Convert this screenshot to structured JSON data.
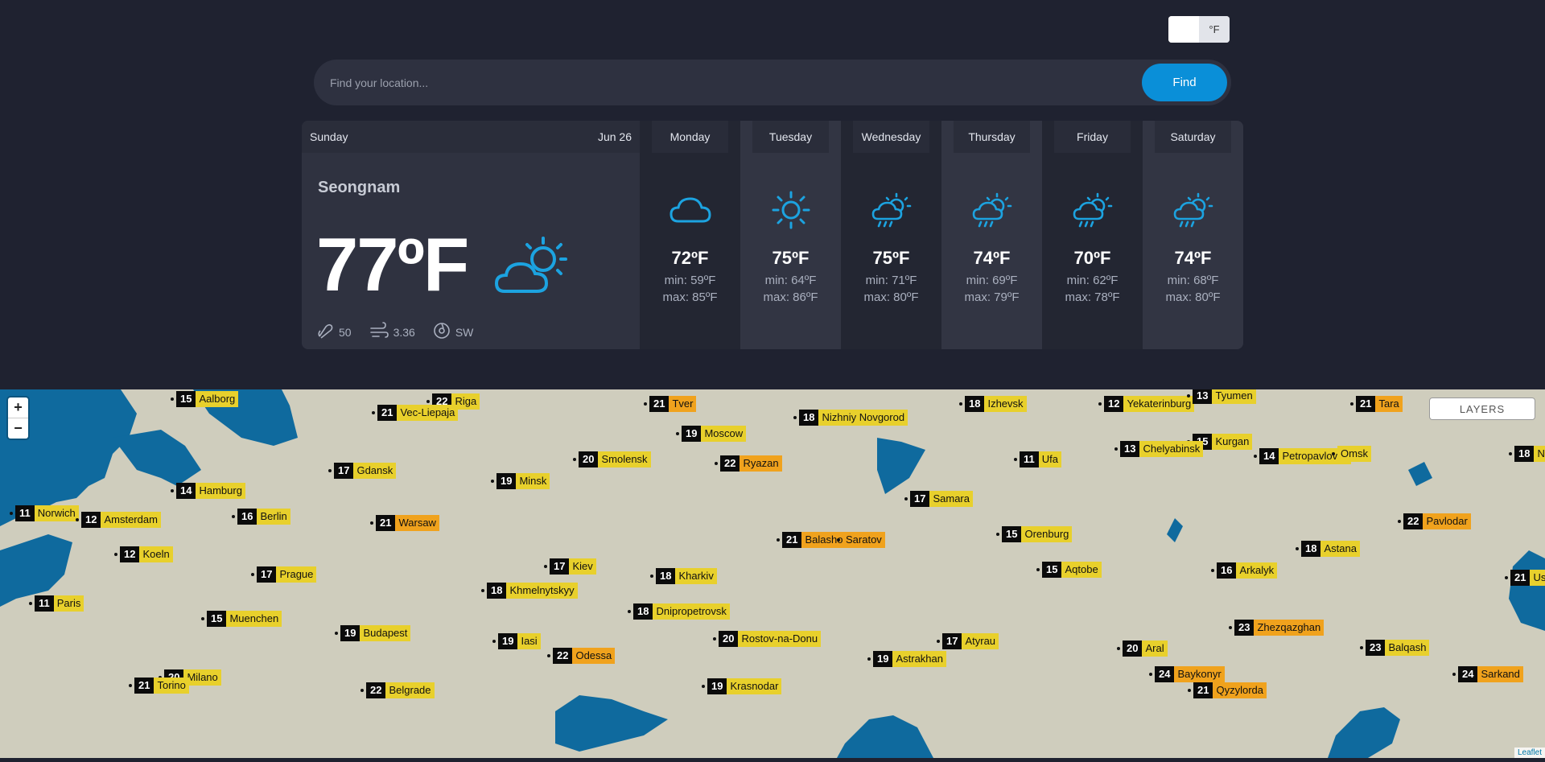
{
  "unit_toggle": {
    "celsius": "",
    "fahrenheit": "°F"
  },
  "search": {
    "placeholder": "Find your location...",
    "button": "Find"
  },
  "today": {
    "day": "Sunday",
    "date": "Jun 26",
    "city": "Seongnam",
    "temp": "77ºF",
    "icon": "partly-cloudy-sun-icon",
    "humidity": "50",
    "wind_speed": "3.36",
    "wind_dir": "SW"
  },
  "days": [
    {
      "name": "Monday",
      "icon": "cloud-icon",
      "hi": "72ºF",
      "min": "min: 59ºF",
      "max": "max: 85ºF"
    },
    {
      "name": "Tuesday",
      "icon": "sun-icon",
      "hi": "75ºF",
      "min": "min: 64ºF",
      "max": "max: 86ºF"
    },
    {
      "name": "Wednesday",
      "icon": "sun-cloud-rain-icon",
      "hi": "75ºF",
      "min": "min: 71ºF",
      "max": "max: 80ºF"
    },
    {
      "name": "Thursday",
      "icon": "sun-cloud-rain-icon",
      "hi": "74ºF",
      "min": "min: 69ºF",
      "max": "max: 79ºF"
    },
    {
      "name": "Friday",
      "icon": "sun-cloud-rain-icon",
      "hi": "70ºF",
      "min": "min: 62ºF",
      "max": "max: 78ºF"
    },
    {
      "name": "Saturday",
      "icon": "sun-cloud-rain-icon",
      "hi": "74ºF",
      "min": "min: 68ºF",
      "max": "max: 80ºF"
    }
  ],
  "map": {
    "zoom_in": "+",
    "zoom_out": "−",
    "layers": "LAYERS",
    "attribution": "Leaflet",
    "cities": [
      {
        "t": "15",
        "n": "Aalborg",
        "c": "y"
      },
      {
        "t": "22",
        "n": "Riga",
        "c": "y"
      },
      {
        "t": "21",
        "n": "Vec-Liepaja",
        "c": "y"
      },
      {
        "t": "21",
        "n": "Tver",
        "c": "o"
      },
      {
        "t": "18",
        "n": "Izhevsk",
        "c": "y"
      },
      {
        "t": "12",
        "n": "Yekaterinburg",
        "c": "y"
      },
      {
        "t": "13",
        "n": "Tyumen",
        "c": "y"
      },
      {
        "t": "21",
        "n": "Tara",
        "c": "o"
      },
      {
        "t": "19",
        "n": "Moscow",
        "c": "y"
      },
      {
        "t": "18",
        "n": "Nizhniy Novgorod",
        "c": "y"
      },
      {
        "t": "15",
        "n": "Kurgan",
        "c": "y"
      },
      {
        "t": "13",
        "n": "Chelyabinsk",
        "c": "y"
      },
      {
        "t": "14",
        "n": "Petropavlovsk",
        "c": "y"
      },
      {
        "t": "",
        "n": "Omsk",
        "c": "y"
      },
      {
        "t": "18",
        "n": "No",
        "c": "y"
      },
      {
        "t": "20",
        "n": "Smolensk",
        "c": "y"
      },
      {
        "t": "22",
        "n": "Ryazan",
        "c": "o"
      },
      {
        "t": "11",
        "n": "Ufa",
        "c": "y"
      },
      {
        "t": "17",
        "n": "Gdansk",
        "c": "y"
      },
      {
        "t": "19",
        "n": "Minsk",
        "c": "y"
      },
      {
        "t": "14",
        "n": "Hamburg",
        "c": "y"
      },
      {
        "t": "17",
        "n": "Samara",
        "c": "y"
      },
      {
        "t": "11",
        "n": "Norwich",
        "c": "y"
      },
      {
        "t": "12",
        "n": "Amsterdam",
        "c": "y"
      },
      {
        "t": "16",
        "n": "Berlin",
        "c": "y"
      },
      {
        "t": "21",
        "n": "Warsaw",
        "c": "o"
      },
      {
        "t": "22",
        "n": "Pavlodar",
        "c": "o"
      },
      {
        "t": "21",
        "n": "Balashov",
        "c": "o"
      },
      {
        "t": "",
        "n": "Saratov",
        "c": "o"
      },
      {
        "t": "15",
        "n": "Orenburg",
        "c": "y"
      },
      {
        "t": "12",
        "n": "Koeln",
        "c": "y"
      },
      {
        "t": "18",
        "n": "Astana",
        "c": "y"
      },
      {
        "t": "17",
        "n": "Kiev",
        "c": "y"
      },
      {
        "t": "15",
        "n": "Aqtobe",
        "c": "y"
      },
      {
        "t": "16",
        "n": "Arkalyk",
        "c": "y"
      },
      {
        "t": "17",
        "n": "Prague",
        "c": "y"
      },
      {
        "t": "18",
        "n": "Kharkiv",
        "c": "y"
      },
      {
        "t": "21",
        "n": "Ust-",
        "c": "y"
      },
      {
        "t": "18",
        "n": "Khmelnytskyy",
        "c": "y"
      },
      {
        "t": "11",
        "n": "Paris",
        "c": "y"
      },
      {
        "t": "18",
        "n": "Dnipropetrovsk",
        "c": "y"
      },
      {
        "t": "15",
        "n": "Muenchen",
        "c": "y"
      },
      {
        "t": "23",
        "n": "Zhezqazghan",
        "c": "o"
      },
      {
        "t": "19",
        "n": "Budapest",
        "c": "y"
      },
      {
        "t": "20",
        "n": "Rostov-na-Donu",
        "c": "y"
      },
      {
        "t": "19",
        "n": "Iasi",
        "c": "y"
      },
      {
        "t": "17",
        "n": "Atyrau",
        "c": "y"
      },
      {
        "t": "23",
        "n": "Balqash",
        "c": "y"
      },
      {
        "t": "20",
        "n": "Aral",
        "c": "y"
      },
      {
        "t": "22",
        "n": "Odessa",
        "c": "o"
      },
      {
        "t": "19",
        "n": "Astrakhan",
        "c": "y"
      },
      {
        "t": "20",
        "n": "Milano",
        "c": "y"
      },
      {
        "t": "24",
        "n": "Baykonyr",
        "c": "o"
      },
      {
        "t": "24",
        "n": "Sarkand",
        "c": "o"
      },
      {
        "t": "21",
        "n": "Torino",
        "c": "y"
      },
      {
        "t": "19",
        "n": "Krasnodar",
        "c": "y"
      },
      {
        "t": "22",
        "n": "Belgrade",
        "c": "y"
      },
      {
        "t": "21",
        "n": "Qyzylorda",
        "c": "o"
      }
    ]
  }
}
